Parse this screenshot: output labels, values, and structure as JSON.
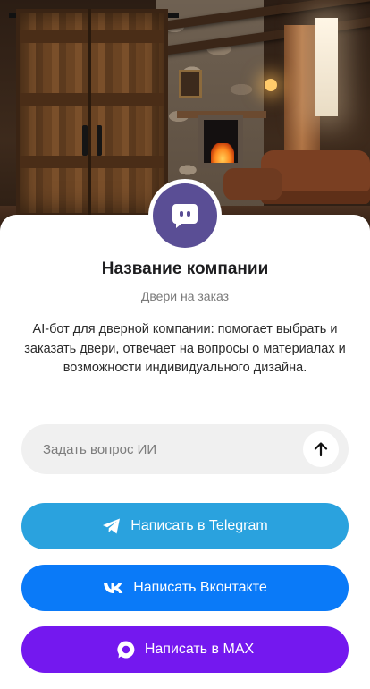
{
  "hero": {
    "image_description_icon": "interior-photo"
  },
  "company": {
    "name": "Название компании",
    "subtitle": "Двери на заказ",
    "description": "AI-бот для дверной компании: помогает выбрать и заказать двери, отвечает на вопросы о материалах и возможности индивидуального дизайна.",
    "avatar_icon": "chat-bubble-icon",
    "avatar_color": "#5a4e95"
  },
  "ask": {
    "placeholder": "Задать вопрос ИИ",
    "value": "",
    "send_icon": "arrow-up-icon"
  },
  "buttons": {
    "telegram": {
      "label": "Написать в Telegram",
      "icon": "telegram-icon",
      "color": "#2aa2de"
    },
    "vk": {
      "label": "Написать Вконтакте",
      "icon": "vk-icon",
      "color": "#0a7af8"
    },
    "max": {
      "label": "Написать в MAX",
      "icon": "max-icon",
      "color": "#7418ef"
    }
  }
}
